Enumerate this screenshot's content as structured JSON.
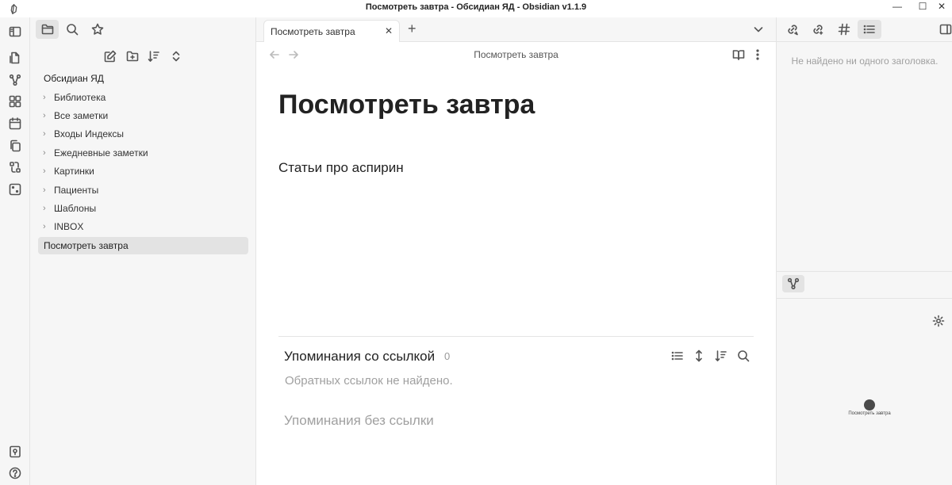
{
  "window": {
    "title": "Посмотреть завтра - Обсидиан ЯД - Obsidian v1.1.9",
    "minimize": "—",
    "maximize": "☐",
    "close": "✕"
  },
  "tabs": {
    "active_label": "Посмотреть завтра",
    "close_glyph": "✕",
    "new_tab_glyph": "+"
  },
  "vault": {
    "name": "Обсидиан ЯД",
    "folders": [
      "Библиотека",
      "Все заметки",
      "Входы Индексы",
      "Ежедневные заметки",
      "Картинки",
      "Пациенты",
      "Шаблоны",
      "INBOX"
    ],
    "active_file": "Посмотреть завтра"
  },
  "editor": {
    "header_title": "Посмотреть завтра",
    "note_title": "Посмотреть завтра",
    "body_text": "Статьи про аспирин"
  },
  "backlinks": {
    "title": "Упоминания со ссылкой",
    "count": "0",
    "none_found": "Обратных ссылок не найдено.",
    "unlinked_title": "Упоминания без ссылки"
  },
  "outline": {
    "empty_text": "Не найдено ни одного заголовка."
  },
  "graph": {
    "node_label": "Посмотреть завтра",
    "node_color": "#4a4a4a"
  },
  "colors": {
    "sidebar_bg": "#f6f6f6",
    "active_item_bg": "#e3e3e3",
    "muted_text": "#a0a0a0"
  },
  "icons": {
    "ribbon_top": [
      "files-icon",
      "graph-icon",
      "canvas-icon",
      "calendar-icon",
      "copy-icon",
      "templates-icon",
      "dice-icon"
    ],
    "ribbon_bottom": [
      "vault-switch-icon",
      "help-icon"
    ]
  }
}
